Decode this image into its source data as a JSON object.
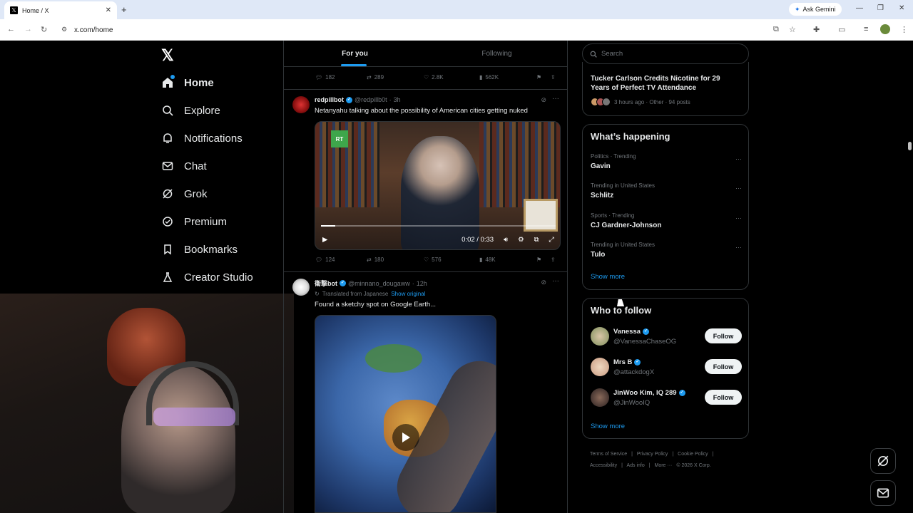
{
  "browser": {
    "tab_title": "Home / X",
    "url": "x.com/home",
    "ask_gemini": "Ask Gemini"
  },
  "nav": {
    "logo": "X",
    "items": [
      {
        "label": "Home",
        "icon": "home-icon",
        "active": true
      },
      {
        "label": "Explore",
        "icon": "search-icon"
      },
      {
        "label": "Notifications",
        "icon": "bell-icon"
      },
      {
        "label": "Chat",
        "icon": "mail-icon"
      },
      {
        "label": "Grok",
        "icon": "grok-icon"
      },
      {
        "label": "Premium",
        "icon": "verified-icon"
      },
      {
        "label": "Bookmarks",
        "icon": "bookmark-icon"
      },
      {
        "label": "Creator Studio",
        "icon": "flask-icon"
      }
    ]
  },
  "timeline": {
    "tabs": [
      {
        "label": "For you",
        "active": true
      },
      {
        "label": "Following",
        "active": false
      }
    ],
    "prev_post_stats": {
      "replies": "182",
      "reposts": "289",
      "likes": "2.8K",
      "views": "562K"
    },
    "posts": [
      {
        "name": "redpillbot",
        "handle": "@redpillb0t",
        "time": "3h",
        "text": "Netanyahu talking about the possibility of American cities getting nuked",
        "video_time": "0:02 / 0:33",
        "video_progress": 0.06,
        "video_channel_logo": "RT",
        "stats": {
          "replies": "124",
          "reposts": "180",
          "likes": "576",
          "views": "48K"
        }
      },
      {
        "name": "衛撃bot",
        "handle": "@minnano_dougaww",
        "time": "12h",
        "translated_label": "Translated from Japanese",
        "show_original": "Show original",
        "text": "Found a sketchy spot on Google Earth..."
      }
    ]
  },
  "sidebar": {
    "search_placeholder": "Search",
    "news": {
      "title": "Tucker Carlson Credits Nicotine for 29 Years of Perfect TV Attendance",
      "meta": "3 hours ago · Other · 94 posts"
    },
    "happening": {
      "heading": "What’s happening",
      "trends": [
        {
          "context": "Politics · Trending",
          "name": "Gavin"
        },
        {
          "context": "Trending in United States",
          "name": "Schlitz"
        },
        {
          "context": "Sports · Trending",
          "name": "CJ Gardner-Johnson"
        },
        {
          "context": "Trending in United States",
          "name": "Tulo"
        }
      ],
      "show_more": "Show more"
    },
    "who_to_follow": {
      "heading": "Who to follow",
      "accounts": [
        {
          "name": "Vanessa",
          "handle": "@VanessaChaseOG",
          "button": "Follow"
        },
        {
          "name": "Mrs B",
          "handle": "@attackdogX",
          "button": "Follow"
        },
        {
          "name": "JinWoo Kim, IQ 289",
          "handle": "@JinWooIQ",
          "button": "Follow"
        }
      ],
      "show_more": "Show more"
    },
    "footer": {
      "line1": [
        "Terms of Service",
        "|",
        "Privacy Policy",
        "|",
        "Cookie Policy",
        "|"
      ],
      "line2": [
        "Accessibility",
        "|",
        "Ads info",
        "|",
        "More ···",
        "© 2026 X Corp."
      ]
    }
  },
  "colors": {
    "accent": "#1d9bf0",
    "background": "#000000",
    "border": "#2f3336",
    "muted": "#71767b"
  }
}
